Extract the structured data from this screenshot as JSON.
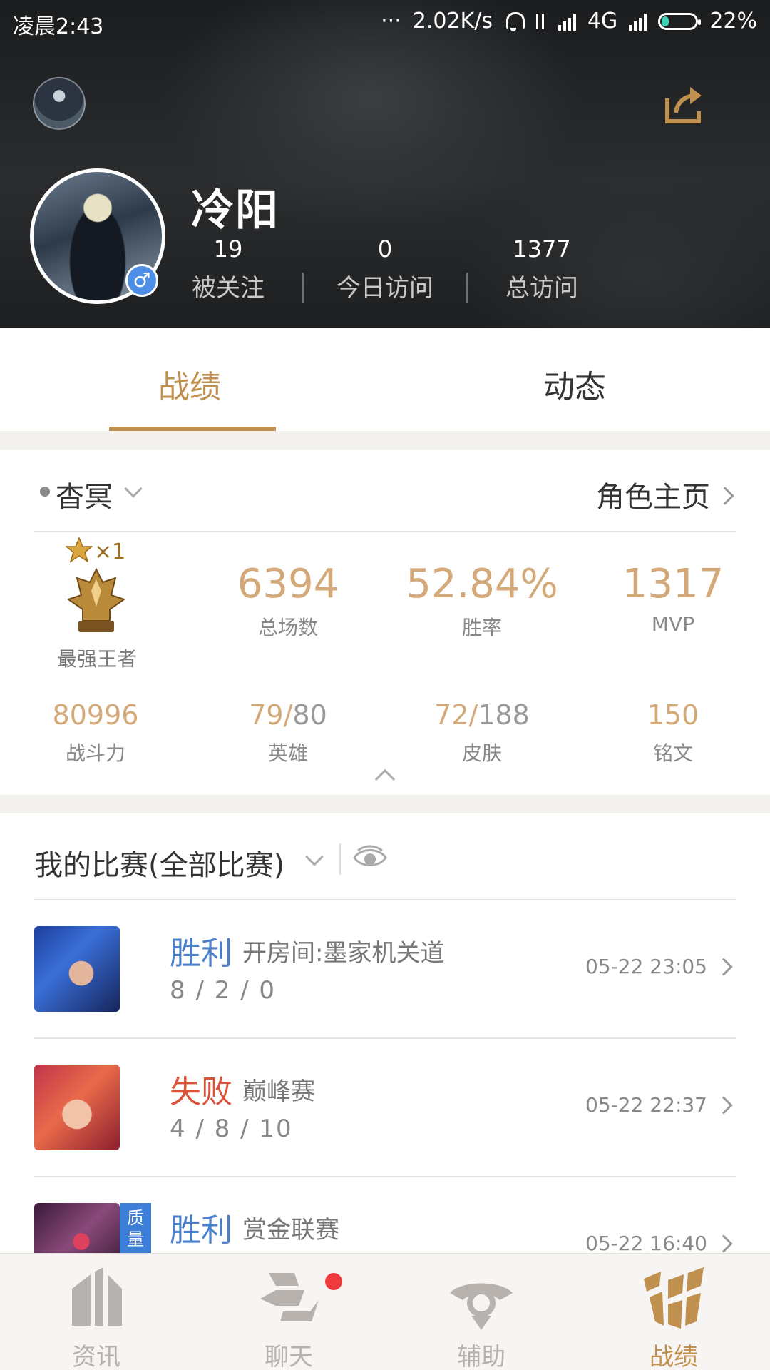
{
  "status_bar": {
    "time": "凌晨2:43",
    "dots": "···",
    "speed": "2.02K/s",
    "network": "4G",
    "battery": "22%",
    "battery_level": 0.22
  },
  "profile": {
    "name": "冷阳",
    "gender_symbol": "♂",
    "stats": [
      {
        "value": "19",
        "label": "被关注"
      },
      {
        "value": "0",
        "label": "今日访问"
      },
      {
        "value": "1377",
        "label": "总访问"
      }
    ]
  },
  "tabs": [
    {
      "label": "战绩",
      "active": true
    },
    {
      "label": "动态",
      "active": false
    }
  ],
  "card": {
    "server": "杳冥",
    "role_home": "角色主页",
    "rank": {
      "multiplier": "×1",
      "name": "最强王者"
    },
    "main_stats": [
      {
        "value": "6394",
        "label": "总场数"
      },
      {
        "value": "52.84%",
        "label": "胜率"
      },
      {
        "value": "1317",
        "label": "MVP"
      }
    ],
    "sub_stats": [
      {
        "value": "80996",
        "denominator": "",
        "label": "战斗力"
      },
      {
        "value": "79/",
        "denominator": "80",
        "label": "英雄"
      },
      {
        "value": "72/",
        "denominator": "188",
        "label": "皮肤"
      },
      {
        "value": "150",
        "denominator": "",
        "label": "铭文"
      }
    ]
  },
  "matches": {
    "title": "我的比赛(全部比赛)",
    "rows": [
      {
        "result": "胜利",
        "outcome": "win",
        "mode": "开房间:墨家机关道",
        "kda": "8 / 2 / 0",
        "time": "05-22 23:05"
      },
      {
        "result": "失败",
        "outcome": "lose",
        "mode": "巅峰赛",
        "kda": "4 / 8 / 10",
        "time": "05-22 22:37"
      },
      {
        "result": "胜利",
        "outcome": "win",
        "mode": "赏金联赛",
        "kda": "",
        "time": "05-22 16:40",
        "badge": "质量"
      }
    ]
  },
  "bottom_nav": [
    {
      "label": "资讯",
      "icon": "news-icon",
      "active": false
    },
    {
      "label": "聊天",
      "icon": "chat-icon",
      "active": false,
      "notification": true
    },
    {
      "label": "辅助",
      "icon": "assist-icon",
      "active": false
    },
    {
      "label": "战绩",
      "icon": "record-icon",
      "active": true
    }
  ],
  "colors": {
    "accent": "#c0904f",
    "win": "#4a7fcc",
    "lose": "#d9533a",
    "stat_gold": "#d4a97a"
  }
}
